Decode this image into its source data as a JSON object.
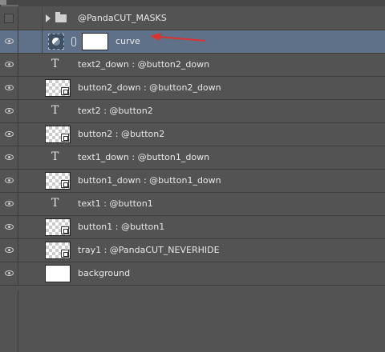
{
  "toolbar": {
    "note": ""
  },
  "layers": [
    {
      "id": "group",
      "label": "@PandaCUT_MASKS"
    },
    {
      "id": "curve",
      "label": "curve"
    },
    {
      "id": "text2_down",
      "label": "text2_down : @button2_down"
    },
    {
      "id": "button2_down",
      "label": "button2_down : @button2_down"
    },
    {
      "id": "text2",
      "label": "text2 : @button2"
    },
    {
      "id": "button2",
      "label": "button2 : @button2"
    },
    {
      "id": "text1_down",
      "label": "text1_down : @button1_down"
    },
    {
      "id": "button1_down",
      "label": "button1_down : @button1_down"
    },
    {
      "id": "text1",
      "label": "text1 : @button1"
    },
    {
      "id": "button1",
      "label": "button1 : @button1"
    },
    {
      "id": "tray1",
      "label": "tray1 : @PandaCUT_NEVERHIDE"
    },
    {
      "id": "background",
      "label": "background"
    }
  ],
  "colors": {
    "panel": "#535353",
    "selected_row": "#5f7188",
    "annotation_arrow": "#e0302c"
  }
}
